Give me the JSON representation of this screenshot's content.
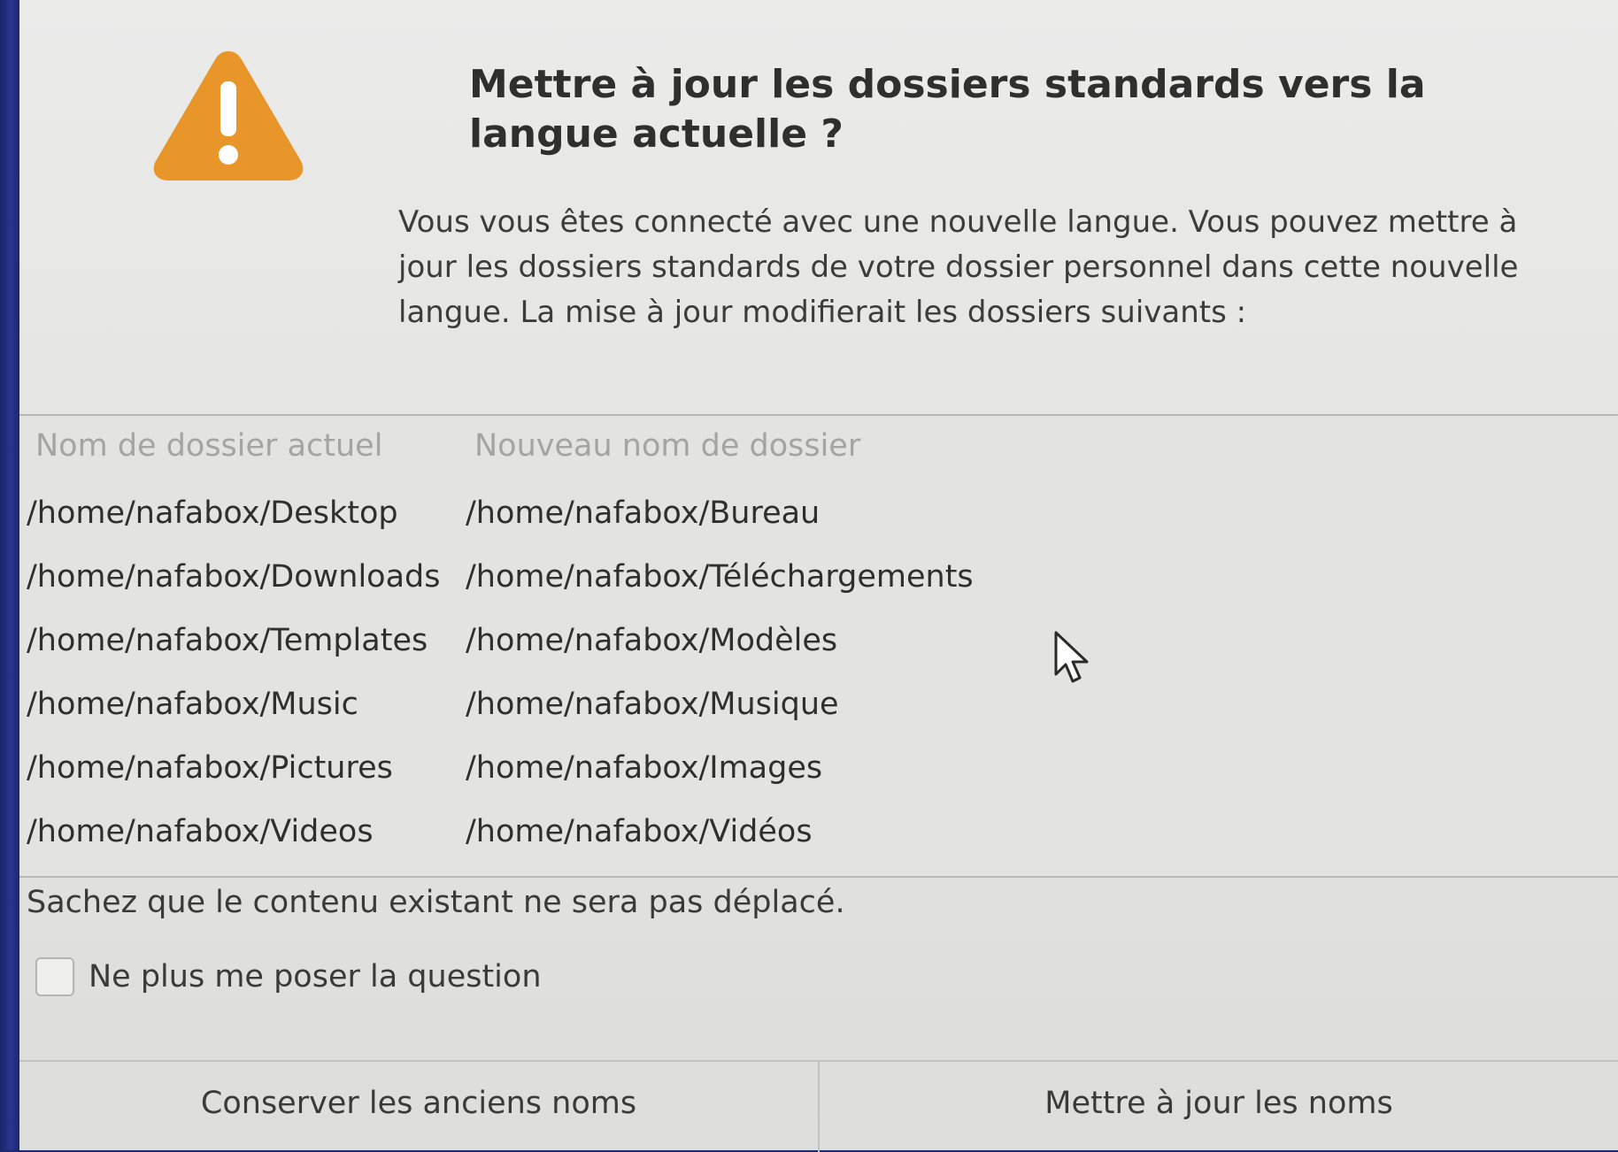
{
  "dialog": {
    "title": "Mettre à jour les dossiers standards vers la langue actuelle ?",
    "message": "Vous vous êtes connecté avec une nouvelle langue. Vous pouvez mettre à jour les dossiers standards de votre dossier personnel dans cette nouvelle langue. La mise à jour modifierait les dossiers suivants :",
    "icon": "warning-icon",
    "accent_color": "#e8962a"
  },
  "table": {
    "headers": [
      "Nom de dossier actuel",
      "Nouveau nom de dossier"
    ],
    "rows": [
      {
        "current": "/home/nafabox/Desktop",
        "new": "/home/nafabox/Bureau"
      },
      {
        "current": "/home/nafabox/Downloads",
        "new": "/home/nafabox/Téléchargements"
      },
      {
        "current": "/home/nafabox/Templates",
        "new": "/home/nafabox/Modèles"
      },
      {
        "current": "/home/nafabox/Music",
        "new": "/home/nafabox/Musique"
      },
      {
        "current": "/home/nafabox/Pictures",
        "new": "/home/nafabox/Images"
      },
      {
        "current": "/home/nafabox/Videos",
        "new": "/home/nafabox/Vidéos"
      }
    ]
  },
  "note": "Sachez que le contenu existant ne sera pas déplacé.",
  "checkbox": {
    "label": "Ne plus me poser la question",
    "checked": false
  },
  "buttons": {
    "keep": "Conserver les anciens noms",
    "update": "Mettre à jour les noms"
  }
}
